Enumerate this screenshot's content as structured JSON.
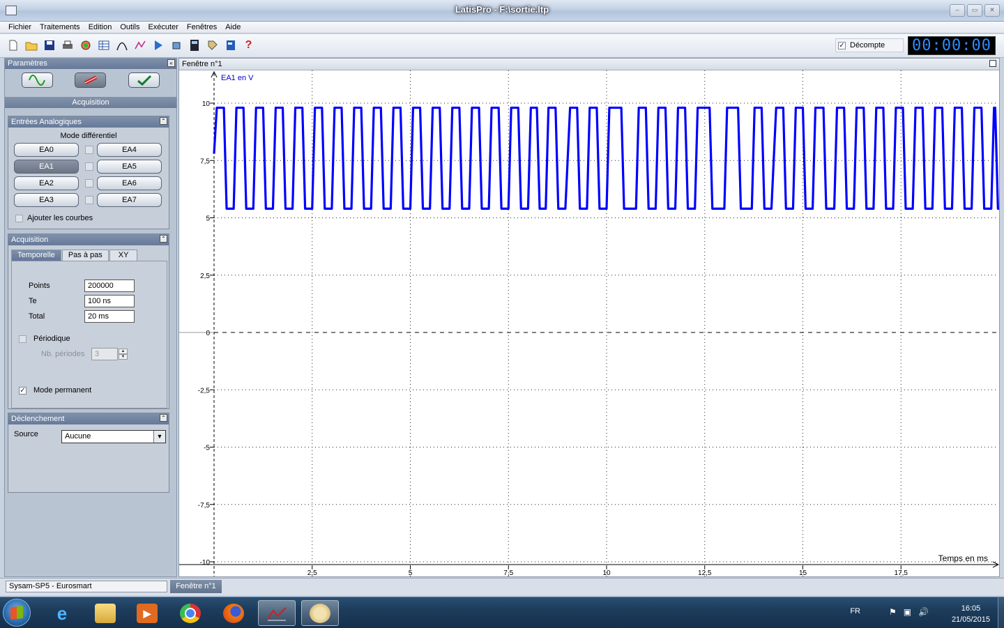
{
  "window": {
    "title": "LatisPro - F:\\sortie.ltp"
  },
  "menu": [
    "Fichier",
    "Traitements",
    "Edition",
    "Outils",
    "Exécuter",
    "Fenêtres",
    "Aide"
  ],
  "toolbar": {
    "icons": [
      "new-file-icon",
      "open-folder-icon",
      "save-icon",
      "print-icon",
      "color-palette-icon",
      "table-icon",
      "curve-icon",
      "modelling-icon",
      "play-icon",
      "eraser-icon",
      "calculator-icon",
      "tag-icon",
      "notebook-icon",
      "help-icon"
    ],
    "help_glyph": "?",
    "decompte_label": "Décompte",
    "decompte_checked": true,
    "timer": "00:00:00"
  },
  "left_panel": {
    "title": "Paramètres",
    "acquisition_label": "Acquisition",
    "analog": {
      "title": "Entrées Analogiques",
      "mode_label": "Mode différentiel",
      "left_channels": [
        "EA0",
        "EA1",
        "EA2",
        "EA3"
      ],
      "right_channels": [
        "EA4",
        "EA5",
        "EA6",
        "EA7"
      ],
      "active_channel": "EA1",
      "add_curves_label": "Ajouter les courbes"
    },
    "acq": {
      "title": "Acquisition",
      "tabs": [
        "Temporelle",
        "Pas à pas",
        "XY"
      ],
      "points_label": "Points",
      "points_value": "200000",
      "te_label": "Te",
      "te_value": "100 ns",
      "total_label": "Total",
      "total_value": "20 ms",
      "periodique_label": "Périodique",
      "nb_periodes_label": "Nb. périodes",
      "nb_periodes_value": "3",
      "mode_permanent_label": "Mode permanent"
    },
    "trigger": {
      "title": "Déclenchement",
      "source_label": "Source",
      "source_value": "Aucune"
    }
  },
  "graph": {
    "window_title": "Fenêtre n°1",
    "series_label": "EA1 en V",
    "x_axis_label": "Temps en ms",
    "x_ticks": [
      "2,5",
      "5",
      "7,5",
      "10",
      "12,5",
      "15",
      "17,5"
    ],
    "y_ticks": [
      "10",
      "7,5",
      "5",
      "2,5",
      "0",
      "-2,5",
      "-5",
      "-7,5",
      "-10"
    ],
    "color": "#0000ff"
  },
  "chart_data": {
    "type": "line",
    "title": "",
    "xlabel": "Temps en ms",
    "ylabel": "EA1 en V",
    "xlim": [
      0,
      20
    ],
    "ylim": [
      -10,
      10.3
    ],
    "series": [
      {
        "name": "EA1 en V",
        "color": "#0000ff",
        "pulses": [
          [
            0.0,
            0.5
          ],
          [
            0.5,
            0.5
          ],
          [
            1.0,
            0.5
          ],
          [
            1.5,
            0.5
          ],
          [
            2.0,
            0.5
          ],
          [
            2.5,
            0.5
          ],
          [
            3.0,
            0.5
          ],
          [
            3.5,
            0.5
          ],
          [
            4.0,
            0.5
          ],
          [
            4.5,
            0.5
          ],
          [
            5.0,
            0.5
          ],
          [
            5.5,
            0.5
          ],
          [
            6.0,
            0.5
          ],
          [
            6.5,
            0.5
          ],
          [
            7.0,
            0.5
          ],
          [
            7.5,
            0.5
          ],
          [
            8.0,
            0.45
          ],
          [
            8.45,
            0.5
          ],
          [
            9.0,
            0.5
          ],
          [
            9.5,
            0.5
          ],
          [
            10.0,
            0.75
          ],
          [
            10.75,
            0.5
          ],
          [
            11.25,
            0.5
          ],
          [
            11.75,
            0.5
          ],
          [
            12.25,
            0.75
          ],
          [
            13.0,
            0.7
          ],
          [
            13.7,
            0.5
          ],
          [
            14.25,
            0.5
          ],
          [
            14.75,
            0.5
          ],
          [
            15.25,
            0.55
          ],
          [
            15.8,
            0.5
          ],
          [
            16.3,
            0.5
          ],
          [
            16.8,
            0.5
          ],
          [
            17.3,
            0.5
          ],
          [
            17.8,
            0.5
          ],
          [
            18.3,
            0.5
          ],
          [
            18.8,
            0.5
          ],
          [
            19.3,
            0.5
          ],
          [
            19.8,
            0.2
          ]
        ],
        "high_v": 9.8,
        "low_v": 5.4
      }
    ]
  },
  "status": {
    "left": "Sysam-SP5 - Eurosmart",
    "tab": "Fenêtre n°1"
  },
  "taskbar": {
    "apps": [
      "windows-explorer-icon",
      "media-player-icon",
      "chrome-icon",
      "firefox-icon",
      "latispro-icon",
      "paint-icon"
    ],
    "lang": "FR",
    "time": "16:05",
    "date": "21/05/2015"
  }
}
